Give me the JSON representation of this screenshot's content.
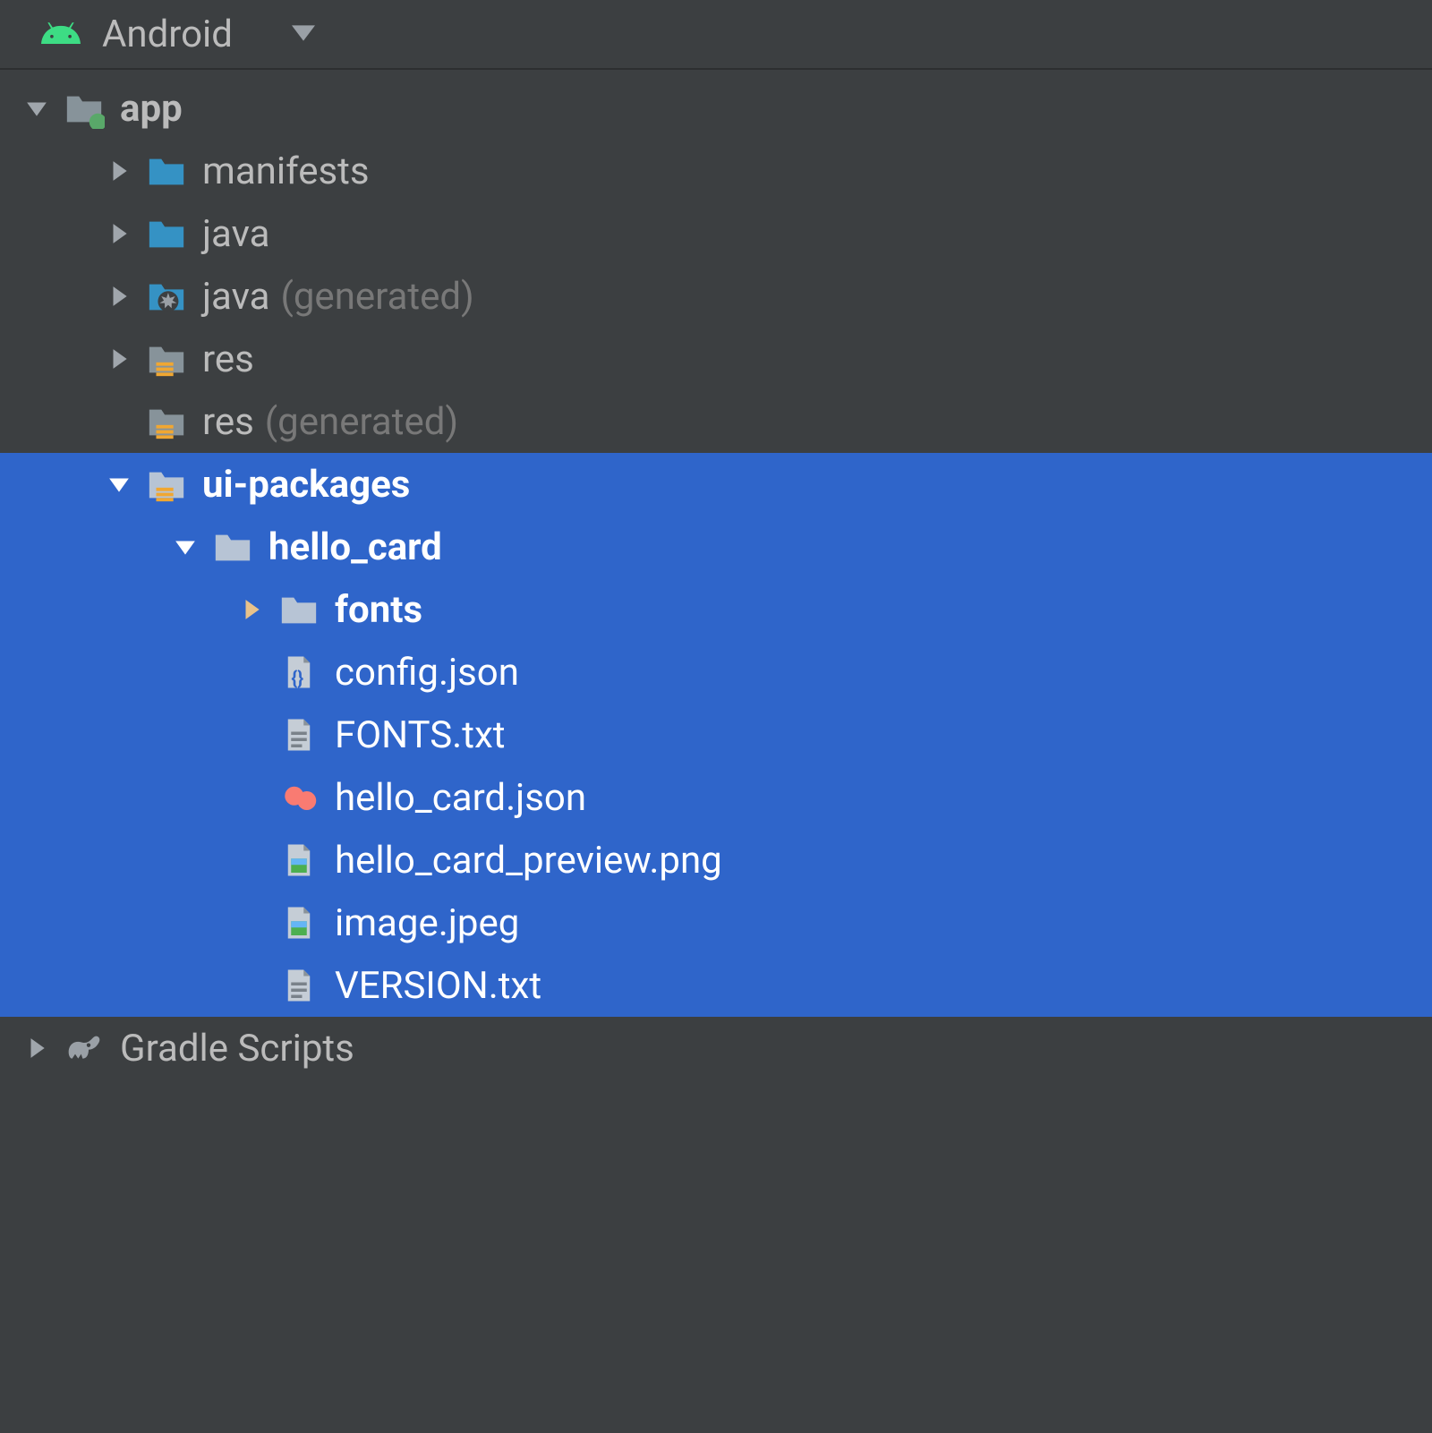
{
  "header": {
    "title": "Android"
  },
  "tree": {
    "app": {
      "label": "app"
    },
    "manifests": {
      "label": "manifests"
    },
    "java": {
      "label": "java"
    },
    "java_gen": {
      "label": "java",
      "annotation": "(generated)"
    },
    "res": {
      "label": "res"
    },
    "res_gen": {
      "label": "res",
      "annotation": "(generated)"
    },
    "ui_packages": {
      "label": "ui-packages"
    },
    "hello_card": {
      "label": "hello_card"
    },
    "fonts": {
      "label": "fonts"
    },
    "config_json": {
      "label": "config.json"
    },
    "fonts_txt": {
      "label": "FONTS.txt"
    },
    "hello_card_json": {
      "label": "hello_card.json"
    },
    "hello_card_preview": {
      "label": "hello_card_preview.png"
    },
    "image_jpeg": {
      "label": "image.jpeg"
    },
    "version_txt": {
      "label": "VERSION.txt"
    },
    "gradle": {
      "label": "Gradle Scripts"
    }
  }
}
